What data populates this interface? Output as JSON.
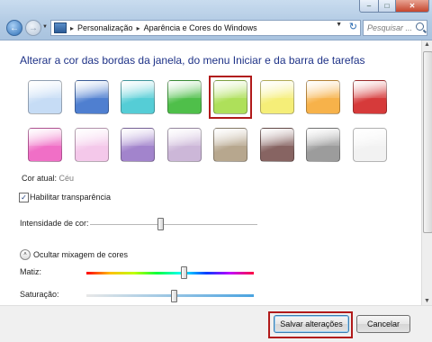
{
  "window": {
    "min_symbol": "–",
    "max_symbol": "□",
    "close_symbol": "✕"
  },
  "nav": {
    "back_symbol": "←",
    "forward_symbol": "→",
    "dropdown_symbol": "▼"
  },
  "address": {
    "separator": "▸",
    "crumbs": [
      "Personalização",
      "Aparência e Cores do Windows"
    ],
    "dropdown_symbol": "▼",
    "refresh_symbol": "↻"
  },
  "search": {
    "placeholder": "Pesquisar ..."
  },
  "heading": "Alterar a cor das bordas da janela, do menu Iniciar e da barra de tarefas",
  "swatches": {
    "row1": [
      "#c6dcf5",
      "#4f7fd0",
      "#55cdd6",
      "#4fbf4a",
      "#aee05a",
      "#f5ee78",
      "#f7b24a",
      "#d63a3a"
    ],
    "row2": [
      "#f06fc6",
      "#f4c8ea",
      "#a284cc",
      "#ccb7d8",
      "#b7a78e",
      "#876462",
      "#9c9c9c",
      "#f2f2f2"
    ],
    "selected": "row1-4"
  },
  "current_color": {
    "label": "Cor atual:",
    "value": "Céu"
  },
  "transparency": {
    "label": "Habilitar transparência",
    "checked": true,
    "check_symbol": "✓"
  },
  "intensity": {
    "label": "Intensidade de cor:",
    "level_percent": 42
  },
  "mixer": {
    "toggle_label": "Ocultar mixagem de cores",
    "toggle_symbol": "˄",
    "hue_label": "Matiz:",
    "hue_percent": 58,
    "saturation_label": "Saturação:",
    "saturation_percent": 52
  },
  "scrollbar": {
    "up_symbol": "▲",
    "down_symbol": "▼"
  },
  "buttons": {
    "save": "Salvar alterações",
    "cancel": "Cancelar"
  }
}
